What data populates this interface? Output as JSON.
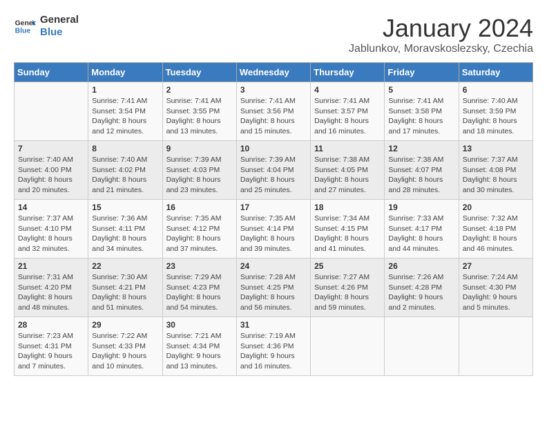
{
  "logo": {
    "line1": "General",
    "line2": "Blue"
  },
  "title": "January 2024",
  "subtitle": "Jablunkov, Moravskoslezsky, Czechia",
  "days_of_week": [
    "Sunday",
    "Monday",
    "Tuesday",
    "Wednesday",
    "Thursday",
    "Friday",
    "Saturday"
  ],
  "weeks": [
    [
      {
        "num": "",
        "detail": ""
      },
      {
        "num": "1",
        "detail": "Sunrise: 7:41 AM\nSunset: 3:54 PM\nDaylight: 8 hours\nand 12 minutes."
      },
      {
        "num": "2",
        "detail": "Sunrise: 7:41 AM\nSunset: 3:55 PM\nDaylight: 8 hours\nand 13 minutes."
      },
      {
        "num": "3",
        "detail": "Sunrise: 7:41 AM\nSunset: 3:56 PM\nDaylight: 8 hours\nand 15 minutes."
      },
      {
        "num": "4",
        "detail": "Sunrise: 7:41 AM\nSunset: 3:57 PM\nDaylight: 8 hours\nand 16 minutes."
      },
      {
        "num": "5",
        "detail": "Sunrise: 7:41 AM\nSunset: 3:58 PM\nDaylight: 8 hours\nand 17 minutes."
      },
      {
        "num": "6",
        "detail": "Sunrise: 7:40 AM\nSunset: 3:59 PM\nDaylight: 8 hours\nand 18 minutes."
      }
    ],
    [
      {
        "num": "7",
        "detail": "Sunrise: 7:40 AM\nSunset: 4:00 PM\nDaylight: 8 hours\nand 20 minutes."
      },
      {
        "num": "8",
        "detail": "Sunrise: 7:40 AM\nSunset: 4:02 PM\nDaylight: 8 hours\nand 21 minutes."
      },
      {
        "num": "9",
        "detail": "Sunrise: 7:39 AM\nSunset: 4:03 PM\nDaylight: 8 hours\nand 23 minutes."
      },
      {
        "num": "10",
        "detail": "Sunrise: 7:39 AM\nSunset: 4:04 PM\nDaylight: 8 hours\nand 25 minutes."
      },
      {
        "num": "11",
        "detail": "Sunrise: 7:38 AM\nSunset: 4:05 PM\nDaylight: 8 hours\nand 27 minutes."
      },
      {
        "num": "12",
        "detail": "Sunrise: 7:38 AM\nSunset: 4:07 PM\nDaylight: 8 hours\nand 28 minutes."
      },
      {
        "num": "13",
        "detail": "Sunrise: 7:37 AM\nSunset: 4:08 PM\nDaylight: 8 hours\nand 30 minutes."
      }
    ],
    [
      {
        "num": "14",
        "detail": "Sunrise: 7:37 AM\nSunset: 4:10 PM\nDaylight: 8 hours\nand 32 minutes."
      },
      {
        "num": "15",
        "detail": "Sunrise: 7:36 AM\nSunset: 4:11 PM\nDaylight: 8 hours\nand 34 minutes."
      },
      {
        "num": "16",
        "detail": "Sunrise: 7:35 AM\nSunset: 4:12 PM\nDaylight: 8 hours\nand 37 minutes."
      },
      {
        "num": "17",
        "detail": "Sunrise: 7:35 AM\nSunset: 4:14 PM\nDaylight: 8 hours\nand 39 minutes."
      },
      {
        "num": "18",
        "detail": "Sunrise: 7:34 AM\nSunset: 4:15 PM\nDaylight: 8 hours\nand 41 minutes."
      },
      {
        "num": "19",
        "detail": "Sunrise: 7:33 AM\nSunset: 4:17 PM\nDaylight: 8 hours\nand 44 minutes."
      },
      {
        "num": "20",
        "detail": "Sunrise: 7:32 AM\nSunset: 4:18 PM\nDaylight: 8 hours\nand 46 minutes."
      }
    ],
    [
      {
        "num": "21",
        "detail": "Sunrise: 7:31 AM\nSunset: 4:20 PM\nDaylight: 8 hours\nand 48 minutes."
      },
      {
        "num": "22",
        "detail": "Sunrise: 7:30 AM\nSunset: 4:21 PM\nDaylight: 8 hours\nand 51 minutes."
      },
      {
        "num": "23",
        "detail": "Sunrise: 7:29 AM\nSunset: 4:23 PM\nDaylight: 8 hours\nand 54 minutes."
      },
      {
        "num": "24",
        "detail": "Sunrise: 7:28 AM\nSunset: 4:25 PM\nDaylight: 8 hours\nand 56 minutes."
      },
      {
        "num": "25",
        "detail": "Sunrise: 7:27 AM\nSunset: 4:26 PM\nDaylight: 8 hours\nand 59 minutes."
      },
      {
        "num": "26",
        "detail": "Sunrise: 7:26 AM\nSunset: 4:28 PM\nDaylight: 9 hours\nand 2 minutes."
      },
      {
        "num": "27",
        "detail": "Sunrise: 7:24 AM\nSunset: 4:30 PM\nDaylight: 9 hours\nand 5 minutes."
      }
    ],
    [
      {
        "num": "28",
        "detail": "Sunrise: 7:23 AM\nSunset: 4:31 PM\nDaylight: 9 hours\nand 7 minutes."
      },
      {
        "num": "29",
        "detail": "Sunrise: 7:22 AM\nSunset: 4:33 PM\nDaylight: 9 hours\nand 10 minutes."
      },
      {
        "num": "30",
        "detail": "Sunrise: 7:21 AM\nSunset: 4:34 PM\nDaylight: 9 hours\nand 13 minutes."
      },
      {
        "num": "31",
        "detail": "Sunrise: 7:19 AM\nSunset: 4:36 PM\nDaylight: 9 hours\nand 16 minutes."
      },
      {
        "num": "",
        "detail": ""
      },
      {
        "num": "",
        "detail": ""
      },
      {
        "num": "",
        "detail": ""
      }
    ]
  ]
}
